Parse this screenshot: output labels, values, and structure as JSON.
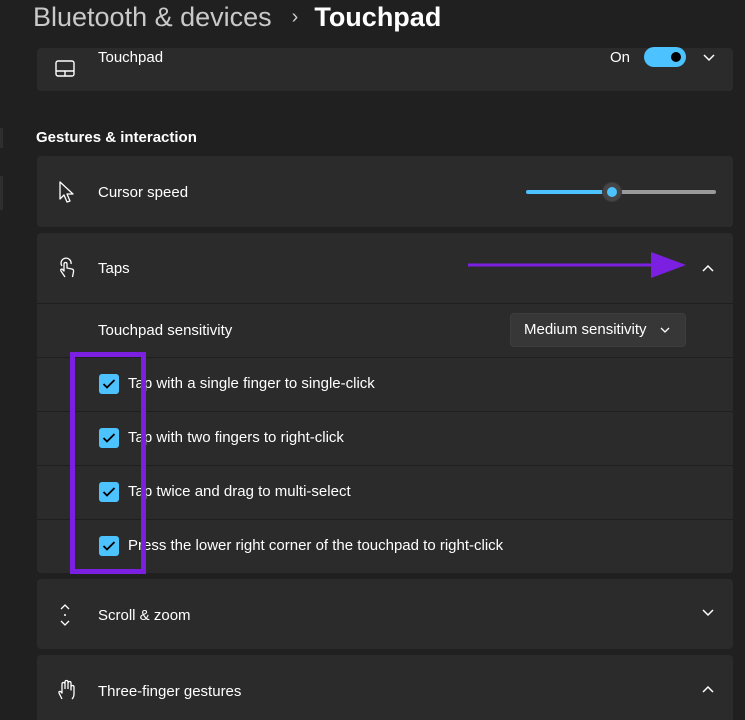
{
  "breadcrumb": {
    "parent": "Bluetooth & devices",
    "separator": "›",
    "current": "Touchpad"
  },
  "touchpad_card": {
    "icon": "touchpad-icon",
    "label": "Touchpad",
    "toggle_state_text": "On",
    "toggle_on": true,
    "expand_icon": "chevron-down-icon"
  },
  "section_heading": "Gestures & interaction",
  "cursor_speed": {
    "icon": "cursor-arrow-icon",
    "label": "Cursor speed",
    "slider_value_fraction": 0.45
  },
  "taps": {
    "icon": "tap-gesture-icon",
    "label": "Taps",
    "expanded": true,
    "collapse_icon": "chevron-up-icon",
    "sensitivity_label": "Touchpad sensitivity",
    "sensitivity_value": "Medium sensitivity",
    "options": [
      {
        "label": "Tap with a single finger to single-click",
        "checked": true
      },
      {
        "label": "Tap with two fingers to right-click",
        "checked": true
      },
      {
        "label": "Tap twice and drag to multi-select",
        "checked": true
      },
      {
        "label": "Press the lower right corner of the touchpad to right-click",
        "checked": true
      }
    ]
  },
  "scroll_zoom": {
    "icon": "scroll-icon",
    "label": "Scroll & zoom",
    "expand_icon": "chevron-down-icon"
  },
  "three_finger": {
    "icon": "three-finger-hand-icon",
    "label": "Three-finger gestures",
    "expand_icon": "chevron-up-icon"
  },
  "colors": {
    "accent": "#4cc2ff",
    "annotation": "#7b1fe0",
    "background": "#202020",
    "card": "#2b2b2b"
  }
}
